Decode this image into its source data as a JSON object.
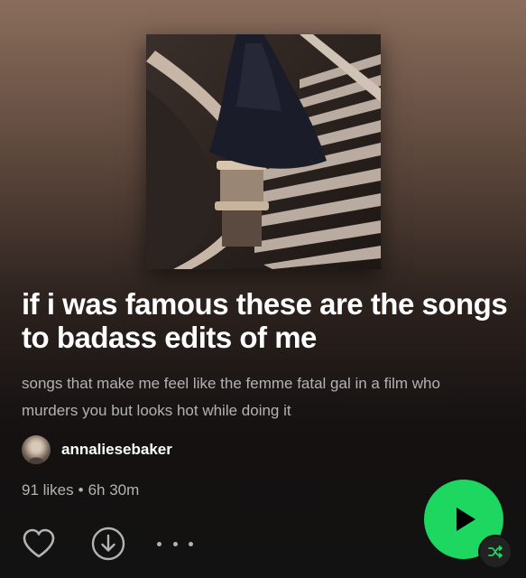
{
  "playlist": {
    "title": "if i was famous these are the songs to badass edits of me",
    "description": "songs that make me feel like the femme fatal gal in a film who murders you but looks hot while doing it",
    "owner": "annaliesebaker",
    "likes": "91 likes",
    "separator": "•",
    "duration": "6h 30m"
  },
  "colors": {
    "accent": "#1ed760",
    "secondary_text": "#b3b3b3",
    "background": "#121212"
  },
  "icons": [
    "heart-icon",
    "download-icon",
    "more-options-icon",
    "play-icon",
    "shuffle-icon"
  ]
}
